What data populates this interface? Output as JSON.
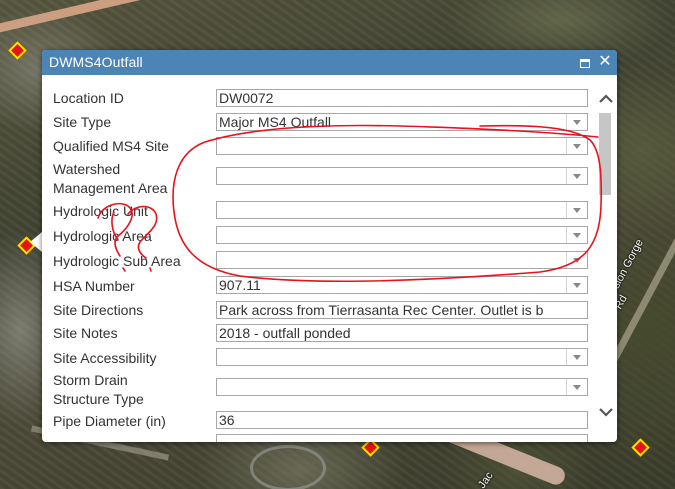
{
  "popup": {
    "title": "DWMS4Outfall",
    "maximize_icon": "maximize-icon",
    "close_icon": "close-icon",
    "close_glyph": "✕",
    "titlebar_color": "#4c84b5"
  },
  "map": {
    "street_label_1": "Mission Gorge Rd",
    "street_label_2": "Jac",
    "marker_color": "#e8121c"
  },
  "fields": [
    {
      "label": "Location ID",
      "value": "DW0072",
      "type": "text"
    },
    {
      "label": "Site Type",
      "value": "Major MS4 Outfall",
      "type": "select"
    },
    {
      "label": "Qualified MS4 Site",
      "value": "",
      "type": "select"
    },
    {
      "label": "Watershed Management Area",
      "label_line1": "Watershed",
      "label_line2": "Management Area",
      "value": "",
      "type": "select"
    },
    {
      "label": "Hydrologic Unit",
      "value": "",
      "type": "select"
    },
    {
      "label": "Hydrologic Area",
      "value": "",
      "type": "select"
    },
    {
      "label": "Hydrologic Sub Area",
      "value": "",
      "type": "select"
    },
    {
      "label": "HSA Number",
      "value": "907.11",
      "type": "select"
    },
    {
      "label": "Site Directions",
      "value": "Park across from Tierrasanta Rec Center. Outlet is b",
      "type": "text"
    },
    {
      "label": "Site Notes",
      "value": "2018 - outfall ponded",
      "type": "text"
    },
    {
      "label": "Site Accessibility",
      "value": "",
      "type": "select"
    },
    {
      "label": "Storm Drain Structure Type",
      "label_line1": "Storm Drain",
      "label_line2": "Structure Type",
      "value": "",
      "type": "select"
    },
    {
      "label": "Pipe Diameter (in)",
      "value": "36",
      "type": "text"
    }
  ],
  "scrollbar": {
    "up_icon": "chevron-up-icon",
    "down_icon": "chevron-down-icon"
  },
  "annotation": {
    "stroke_color": "#e8121c"
  }
}
